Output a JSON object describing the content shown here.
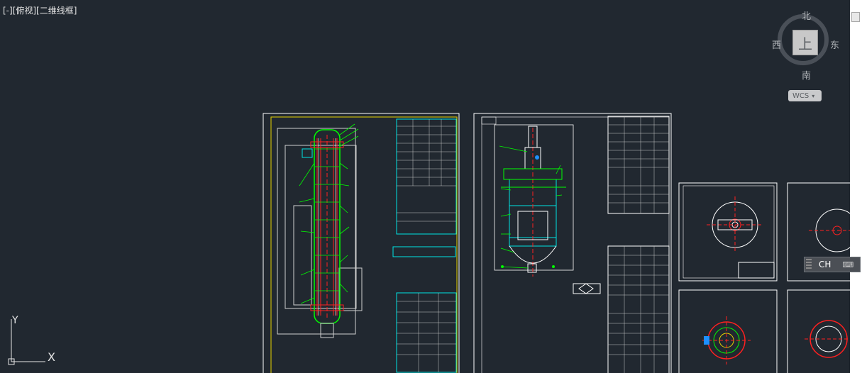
{
  "viewport": {
    "label": "[-][俯视][二维线框]"
  },
  "viewcube": {
    "face": "上",
    "north": "北",
    "south": "南",
    "east": "东",
    "west": "西",
    "wcs_label": "WCS",
    "wcs_arrow_icon": "chevron-down-icon"
  },
  "ime": {
    "lang": "CH",
    "keyboard_icon": "keyboard-icon"
  },
  "ucs": {
    "x_label": "X",
    "y_label": "Y"
  },
  "colors": {
    "background": "#212830",
    "frame": "#ffffff",
    "border_yellow": "#e6d300",
    "geometry_green": "#00ff00",
    "centerline_red": "#ff2020",
    "table_cyan": "#00e5e5"
  }
}
